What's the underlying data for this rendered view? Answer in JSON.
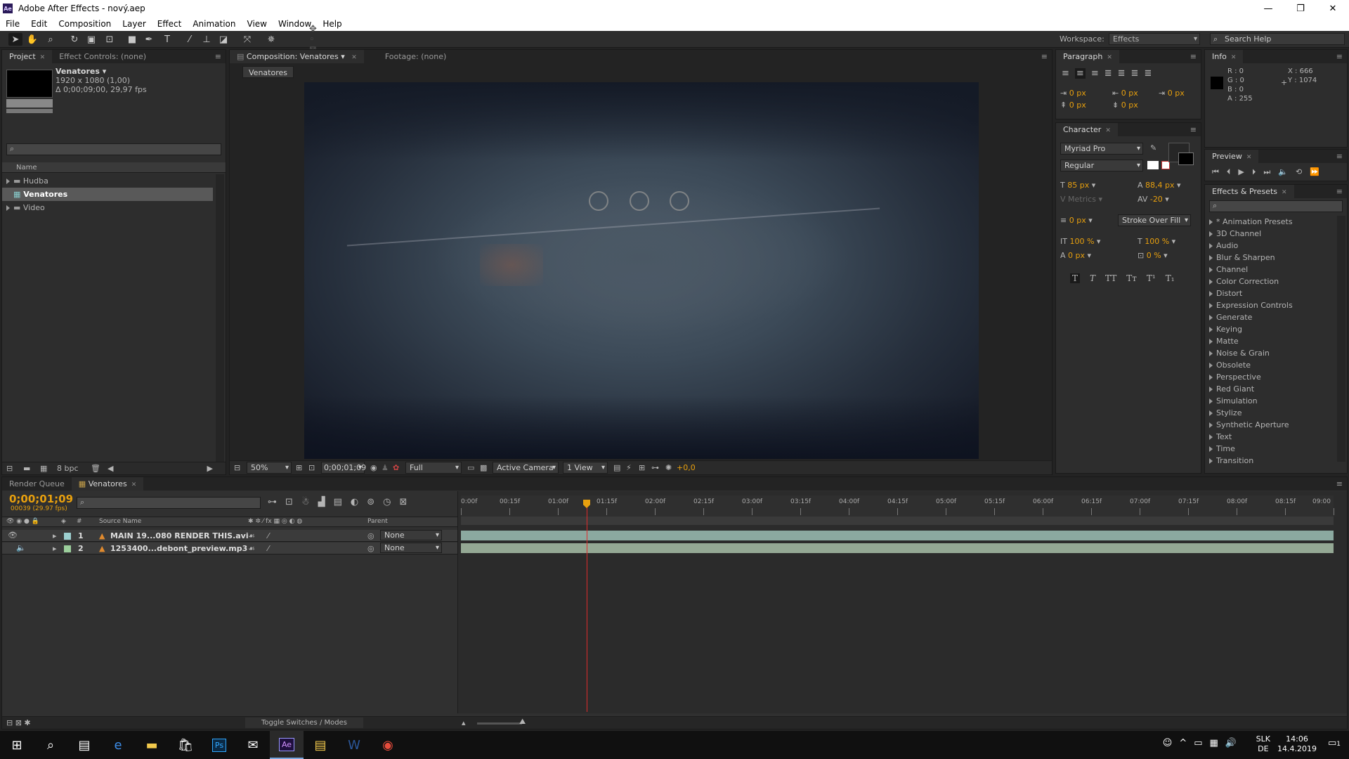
{
  "window": {
    "title": "Adobe After Effects - nový.aep",
    "app_icon": "Ae"
  },
  "menu": [
    "File",
    "Edit",
    "Composition",
    "Layer",
    "Effect",
    "Animation",
    "View",
    "Window",
    "Help"
  ],
  "toolbar": {
    "workspace_label": "Workspace:",
    "workspace_value": "Effects",
    "search_help": "Search Help"
  },
  "project": {
    "tabs": [
      "Project",
      "Effect Controls: (none)"
    ],
    "comp_name": "Venatores ▾",
    "comp_size": "1920 x 1080 (1,00)",
    "comp_duration": "Δ 0;00;09;00, 29,97 fps",
    "col_name": "Name",
    "items": [
      {
        "label": "Hudba",
        "type": "folder"
      },
      {
        "label": "Venatores",
        "type": "comp"
      },
      {
        "label": "Video",
        "type": "folder"
      }
    ],
    "bpc": "8 bpc"
  },
  "composition": {
    "tab": "Composition: Venatores",
    "footage_tab": "Footage: (none)",
    "subtab": "Venatores",
    "zoom": "50%",
    "timecode": "0;00;01;09",
    "resolution": "Full",
    "camera": "Active Camera",
    "views": "1 View",
    "exposure": "+0,0"
  },
  "paragraph": {
    "tab": "Paragraph",
    "fields": [
      "0 px",
      "0 px",
      "0 px",
      "0 px",
      "0 px"
    ]
  },
  "character": {
    "tab": "Character",
    "font": "Myriad Pro",
    "style": "Regular",
    "size": "85 px",
    "leading": "88,4 px",
    "kerning": "Metrics",
    "tracking": "-20",
    "stroke": "0 px",
    "stroke_mode": "Stroke Over Fill",
    "vscale": "100 %",
    "hscale": "100 %",
    "baseline": "0 px",
    "tsume": "0 %",
    "styles": [
      "T",
      "T",
      "TT",
      "Tт",
      "T¹",
      "T₁"
    ]
  },
  "info": {
    "tab": "Info",
    "r": "R : 0",
    "g": "G : 0",
    "b": "B : 0",
    "a": "A : 255",
    "x": "X : 666",
    "y": "Y : 1074"
  },
  "preview": {
    "tab": "Preview"
  },
  "effects": {
    "tab": "Effects & Presets",
    "items": [
      "* Animation Presets",
      "3D Channel",
      "Audio",
      "Blur & Sharpen",
      "Channel",
      "Color Correction",
      "Distort",
      "Expression Controls",
      "Generate",
      "Keying",
      "Matte",
      "Noise & Grain",
      "Obsolete",
      "Perspective",
      "Red Giant",
      "Simulation",
      "Stylize",
      "Synthetic Aperture",
      "Text",
      "Time",
      "Transition"
    ]
  },
  "timeline": {
    "tabs": [
      "Render Queue",
      "Venatores"
    ],
    "timecode": "0;00;01;09",
    "frames": "00039 (29.97 fps)",
    "col_source": "Source Name",
    "col_parent": "Parent",
    "layers": [
      {
        "num": "1",
        "name": "MAIN 19...080 RENDER THIS.avi",
        "parent": "None"
      },
      {
        "num": "2",
        "name": "1253400...debont_preview.mp3",
        "parent": "None"
      }
    ],
    "ruler": [
      "0:00f",
      "00:15f",
      "01:00f",
      "01:15f",
      "02:00f",
      "02:15f",
      "03:00f",
      "03:15f",
      "04:00f",
      "04:15f",
      "05:00f",
      "05:15f",
      "06:00f",
      "06:15f",
      "07:00f",
      "07:15f",
      "08:00f",
      "08:15f",
      "09:00"
    ],
    "playhead_sec": 1.3,
    "duration_sec": 9,
    "toggle": "Toggle Switches / Modes"
  },
  "taskbar": {
    "lang1": "SLK",
    "lang2": "DE",
    "time": "14:06",
    "date": "14.4.2019",
    "notif": "1"
  }
}
